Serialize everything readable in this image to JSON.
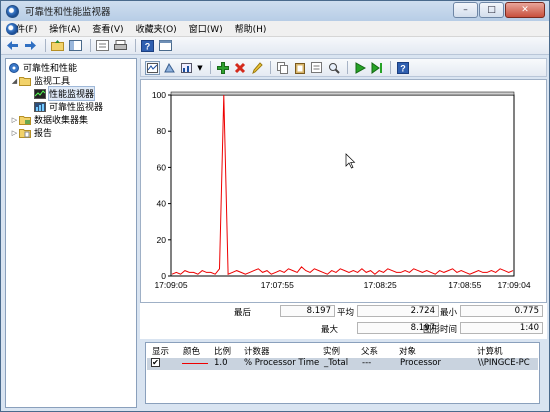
{
  "window": {
    "title": "可靠性和性能监视器"
  },
  "menu": [
    "文件(F)",
    "操作(A)",
    "查看(V)",
    "收藏夹(O)",
    "窗口(W)",
    "帮助(H)"
  ],
  "window_buttons": {
    "minimize": "–",
    "maximize": "□",
    "close": "✕"
  },
  "tree": {
    "root": "可靠性和性能",
    "monitoring_tools": "监视工具",
    "performance_monitor": "性能监视器",
    "reliability_monitor": "可靠性监视器",
    "data_collector_sets": "数据收集器集",
    "reports": "报告"
  },
  "chart_data": {
    "type": "line",
    "title": "",
    "ylim": [
      0,
      100
    ],
    "yticks": [
      "0",
      "20",
      "40",
      "60",
      "80",
      "100"
    ],
    "xticks": [
      "17:09:05",
      "17:07:55",
      "17:08:25",
      "17:08:55",
      "17:09:04"
    ],
    "series": [
      {
        "color": "#ee0000",
        "values": [
          1,
          2,
          1,
          3,
          2,
          2,
          1,
          3,
          2,
          2,
          1,
          4,
          100,
          1,
          2,
          3,
          2,
          1,
          2,
          3,
          4,
          2,
          3,
          1,
          2,
          3,
          2,
          4,
          3,
          2,
          5,
          3,
          2,
          4,
          3,
          2,
          1,
          3,
          2,
          4,
          3,
          2,
          3,
          2,
          4,
          2,
          3,
          1,
          3,
          2,
          4,
          3,
          2,
          2,
          3,
          2,
          4,
          3,
          2,
          3,
          2,
          1,
          3,
          2,
          3,
          4,
          2,
          3,
          2,
          1,
          2,
          3,
          2,
          2,
          3,
          2,
          4,
          3,
          2,
          3
        ]
      }
    ]
  },
  "stats": {
    "last_label": "最后",
    "last_value": "8.197",
    "avg_label": "平均",
    "avg_value": "2.724",
    "min_label": "最小",
    "min_value": "0.775",
    "max_label": "最大",
    "max_value": "8.197",
    "duration_label": "图形时间",
    "duration_value": "1:40"
  },
  "counter_table": {
    "headers": {
      "show": "显示",
      "color": "颜色",
      "scale": "比例",
      "counter": "计数器",
      "instance": "实例",
      "parent": "父系",
      "object": "对象",
      "computer": "计算机"
    },
    "rows": [
      {
        "checked": "✔",
        "scale": "1.0",
        "counter": "% Processor Time",
        "instance": "_Total",
        "parent": "---",
        "object": "Processor",
        "computer": "\\\\PINGCE-PC",
        "color": "#ee0000"
      }
    ]
  }
}
